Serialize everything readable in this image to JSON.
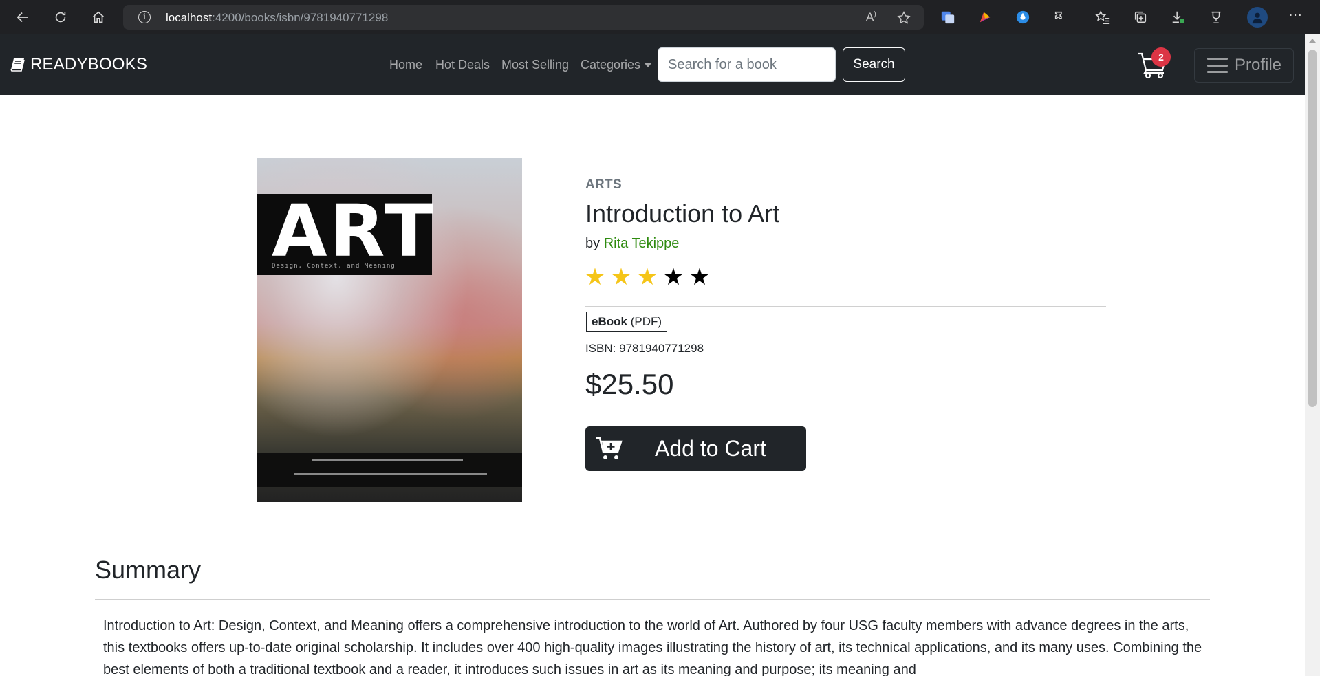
{
  "browser": {
    "url_host": "localhost",
    "url_rest": ":4200/books/isbn/9781940771298"
  },
  "navbar": {
    "brand": "READYBOOKS",
    "links": [
      "Home",
      "Hot Deals",
      "Most Selling",
      "Categories"
    ],
    "search_placeholder": "Search for a book",
    "search_button": "Search",
    "cart_count": "2",
    "profile_label": "Profile"
  },
  "book": {
    "category": "ARTS",
    "title": "Introduction to Art",
    "by_label": "by",
    "author": "Rita Tekippe",
    "rating": 3,
    "rating_max": 5,
    "format_bold": "eBook",
    "format_rest": "(PDF)",
    "isbn": "ISBN: 9781940771298",
    "price": "$25.50",
    "add_to_cart": "Add to Cart",
    "cover_title": "ART",
    "cover_subtitle": "Design, Context, and Meaning"
  },
  "summary": {
    "heading": "Summary",
    "text": "Introduction to Art: Design, Context, and Meaning offers a comprehensive introduction to the world of Art. Authored by four USG faculty members with advance degrees in the arts, this textbooks offers up-to-date original scholarship. It includes over 400 high-quality images illustrating the history of art, its technical applications, and its many uses. Combining the best elements of both a traditional textbook and a reader, it introduces such issues in art as its meaning and purpose; its meaning and"
  },
  "colors": {
    "navbar_bg": "#212529",
    "author_link": "#2e8b0f",
    "star_on": "#f5c518",
    "badge": "#dc3545"
  }
}
